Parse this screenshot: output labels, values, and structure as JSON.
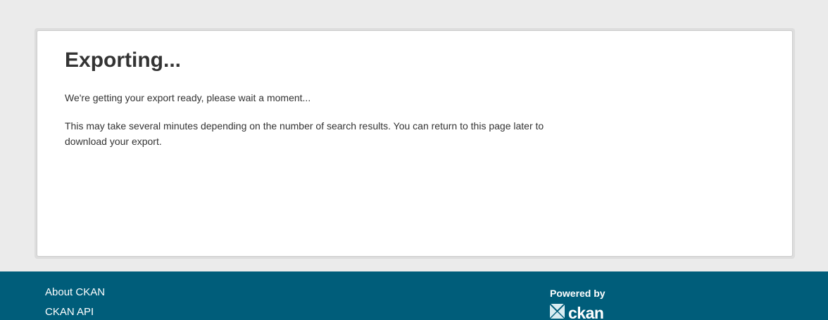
{
  "main": {
    "title": "Exporting...",
    "message": "We're getting your export ready, please wait a moment...",
    "note": "This may take several minutes depending on the number of search results. You can return to this page later to download your export."
  },
  "footer": {
    "links": [
      {
        "label": "About CKAN"
      },
      {
        "label": "CKAN API"
      }
    ],
    "powered_by_label": "Powered by",
    "logo_text": "ckan",
    "logo_icon": "ckan-logo-icon"
  },
  "colors": {
    "background": "#ebebeb",
    "footer": "#005d7a",
    "text": "#333333"
  }
}
